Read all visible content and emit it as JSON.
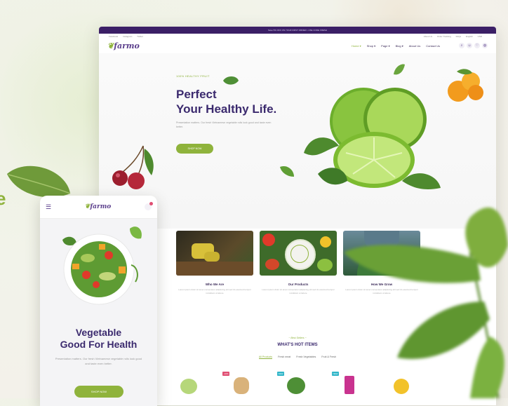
{
  "colors": {
    "brand_purple": "#3b2a6e",
    "accent_green": "#8fb33c",
    "topbar": "#3b1f66"
  },
  "desktop": {
    "topbar_text": "Save 5% OFF ON YOUR FIRST ORDER • USE CODE FRESH",
    "utility_left": [
      "Facebook",
      "Instagram",
      "Twitter"
    ],
    "utility_right": [
      "About Us",
      "Order Tracking",
      "FAQs",
      "English",
      "USD"
    ],
    "logo": "farmo",
    "menu": [
      {
        "label": "Home ▾",
        "active": true
      },
      {
        "label": "Shop ▾",
        "active": false
      },
      {
        "label": "Page ▾",
        "active": false
      },
      {
        "label": "Blog ▾",
        "active": false
      },
      {
        "label": "About Us",
        "active": false
      },
      {
        "label": "Contact Us",
        "active": false
      }
    ],
    "nav_icons": [
      "search-icon",
      "user-icon",
      "heart-icon",
      "cart-icon"
    ],
    "hero": {
      "eyebrow": "100% HEALTHY FRUIT",
      "title_line1": "Perfect",
      "title_line2": "Your Healthy Life.",
      "description": "Presentation matters. Our fresh Vietnamese vegetable rolls look good and taste even better.",
      "button": "SHOP NOW"
    },
    "features": [
      {
        "title": "Who We Are",
        "desc": "Lorem ipsum dolor sit amet consectetur adipiscing elit sed do eiusmod tempor incididunt ut labore"
      },
      {
        "title": "Our Products",
        "desc": "Lorem ipsum dolor sit amet consectetur adipiscing elit sed do eiusmod tempor incididunt ut labore"
      },
      {
        "title": "How We Grow",
        "desc": "Lorem ipsum dolor sit amet consectetur adipiscing elit sed do eiusmod tempor incididunt ut labore"
      }
    ],
    "hot": {
      "subtitle": "~ Best Sellers ~",
      "title": "WHAT'S HOT ITEMS",
      "tabs": [
        {
          "label": "All Products",
          "active": true
        },
        {
          "label": "Fresh meat",
          "active": false
        },
        {
          "label": "Fresh Vegetables",
          "active": false
        },
        {
          "label": "Fruit & Fresh",
          "active": false
        }
      ],
      "badges": [
        "-10%",
        "NEW",
        "NEW"
      ]
    }
  },
  "mobile": {
    "menu_icon": "☰",
    "logo": "farmo",
    "title_line1": "Vegetable",
    "title_line2": "Good For Health",
    "description": "Presentation matters. Our fresh Vietnamese vegetable rolls look good and taste even better.",
    "button": "SHOP NOW"
  },
  "side_text": "e"
}
